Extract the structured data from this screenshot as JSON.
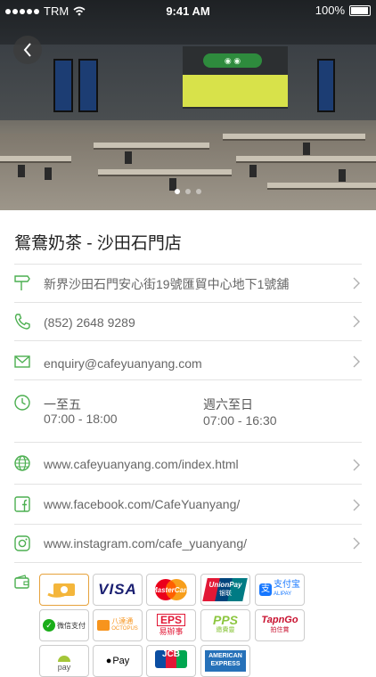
{
  "status_bar": {
    "carrier": "TRM",
    "time": "9:41 AM",
    "battery": "100%"
  },
  "shop": {
    "name": "鴛鴦奶茶 - 沙田石門店"
  },
  "details": {
    "address": "新界沙田石門安心街19號匯貿中心地下1號舖",
    "phone": "(852) 2648 9289",
    "email": "enquiry@cafeyuanyang.com",
    "website": "www.cafeyuanyang.com/index.html",
    "facebook": "www.facebook.com/CafeYuanyang/",
    "instagram": "www.instagram.com/cafe_yuanyang/"
  },
  "hours": {
    "weekday_label": "一至五",
    "weekday_time": "07:00 - 18:00",
    "weekend_label": "週六至日",
    "weekend_time": "07:00 - 16:30"
  },
  "carousel": {
    "pages": 3,
    "active": 0
  },
  "payments": {
    "visa": "VISA",
    "mastercard": "MasterCard",
    "unionpay": "UnionPay",
    "unionpay_cn": "银联",
    "alipay": "支付宝",
    "alipay_en": "ALIPAY",
    "wechat": "微信支付",
    "octopus": "八達通",
    "octopus_en": "OCTOPUS",
    "eps": "EPS",
    "eps_cn": "易辦事",
    "pps": "PPS",
    "pps_cn": "繳費靈",
    "tapgo": "TapnGo",
    "tapgo_cn": "拍住賞",
    "android_pay": "pay",
    "apple_pay": "Pay",
    "jcb": "JCB",
    "amex": "AMERICAN EXPRESS"
  },
  "colors": {
    "icon": "#4caf50",
    "chevron": "#b0b0b0"
  }
}
